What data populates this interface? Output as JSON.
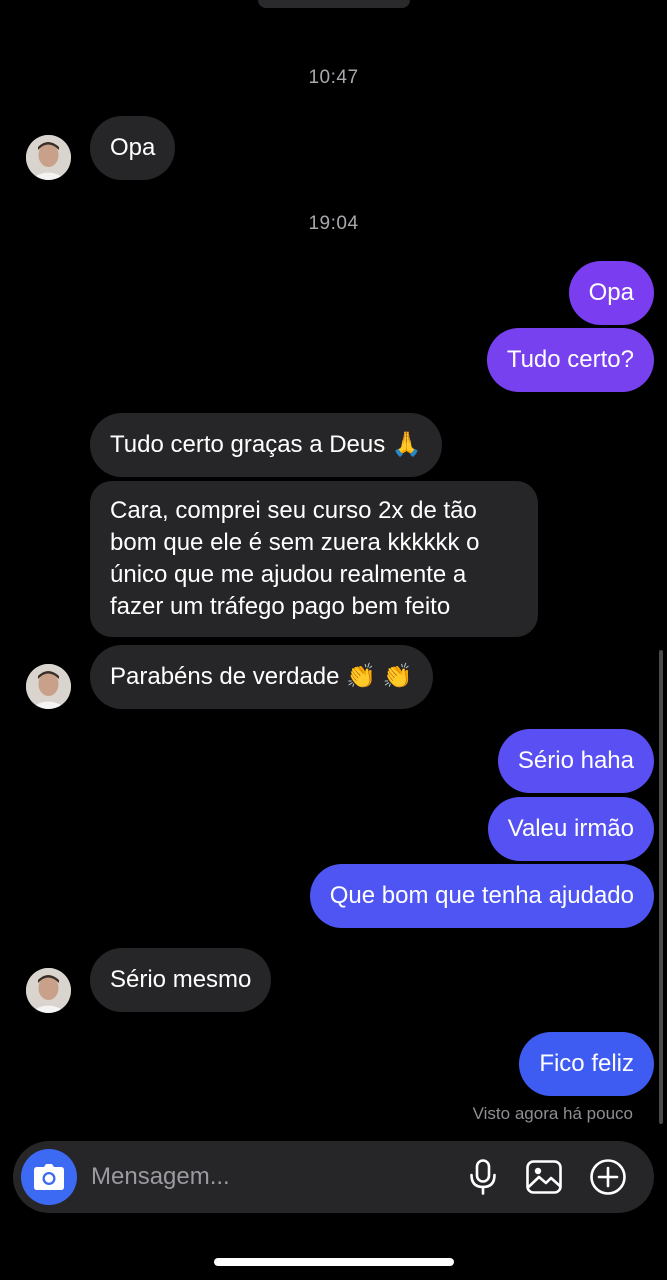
{
  "conversation": {
    "timestamps": [
      "10:47",
      "19:04"
    ],
    "messages": [
      {
        "direction": "in",
        "text": "Opa"
      },
      {
        "direction": "out",
        "text": "Opa"
      },
      {
        "direction": "out",
        "text": "Tudo certo?"
      },
      {
        "direction": "in",
        "text": "Tudo certo graças a Deus 🙏"
      },
      {
        "direction": "in",
        "text": "Cara, comprei seu curso 2x de tão bom que ele é sem zuera kkkkkk o único que me ajudou realmente a fazer um tráfego pago bem feito"
      },
      {
        "direction": "in",
        "text": "Parabéns de verdade 👏 👏"
      },
      {
        "direction": "out",
        "text": "Sério haha"
      },
      {
        "direction": "out",
        "text": "Valeu irmão"
      },
      {
        "direction": "out",
        "text": "Que bom que tenha ajudado"
      },
      {
        "direction": "in",
        "text": "Sério mesmo"
      },
      {
        "direction": "out",
        "text": "Fico feliz"
      }
    ],
    "seen_status": "Visto agora há pouco"
  },
  "composer": {
    "placeholder": "Mensagem...",
    "camera_icon": "camera-icon",
    "icons": [
      "microphone-icon",
      "image-icon",
      "plus-circle-icon"
    ]
  },
  "colors": {
    "background": "#000000",
    "incoming_bubble": "#262628",
    "outgoing_purple": "#7a3ef0",
    "outgoing_blue": "#3f5cf2",
    "camera_button": "#3d6af2"
  }
}
